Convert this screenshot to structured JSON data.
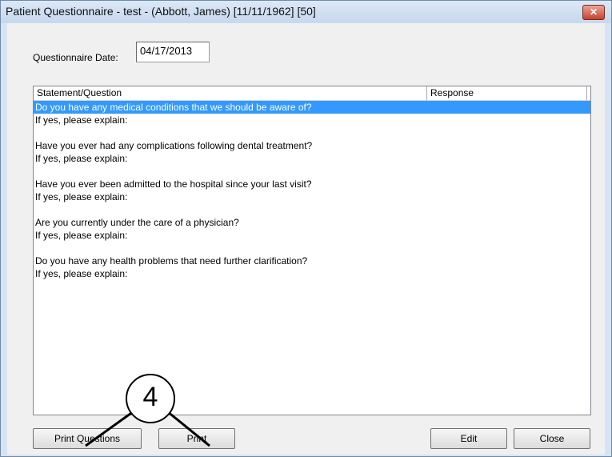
{
  "window": {
    "title": "Patient Questionnaire - test - (Abbott, James) [11/11/1962] [50]",
    "close_glyph": "✕"
  },
  "date": {
    "label": "Questionnaire Date:",
    "value": "04/17/2013"
  },
  "table": {
    "headers": [
      "Statement/Question",
      "Response"
    ],
    "rows": [
      "Do you have any medical conditions that we should be aware of?",
      "If yes, please explain:",
      "",
      "Have you ever had any complications following dental treatment?",
      "If yes, please explain:",
      "",
      "Have you ever been admitted to the hospital since your last visit?",
      "If yes, please explain:",
      "",
      "Are you currently under the care of a physician?",
      "If yes, please explain:",
      "",
      "Do you have any health problems that need further clarification?",
      "If yes, please explain:"
    ],
    "selected_row": 0
  },
  "buttons": {
    "print_questions": "Print Questions",
    "print": "Print",
    "edit": "Edit",
    "close": "Close"
  },
  "callout": {
    "number": "4"
  },
  "colors": {
    "selection": "#3399ff",
    "client_bg": "#f0f0f0",
    "title_bg": "#d6e3f2"
  }
}
